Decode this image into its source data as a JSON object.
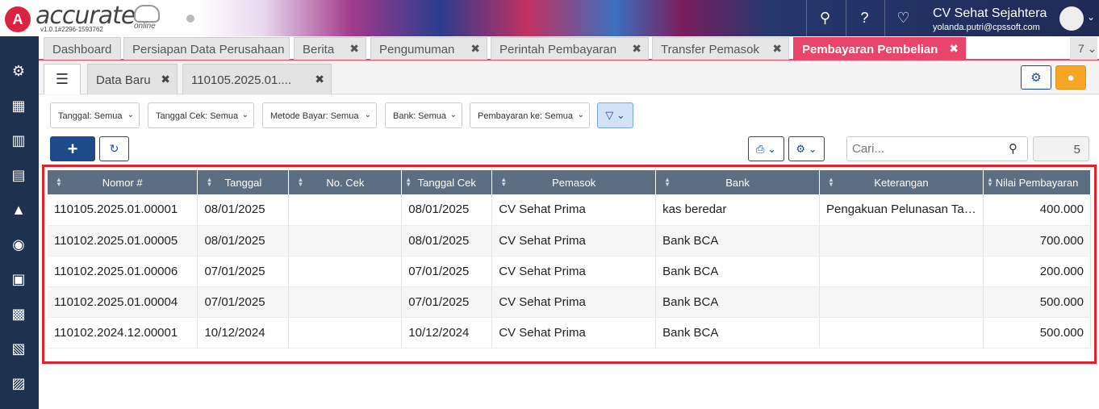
{
  "header": {
    "brand": "accurate",
    "brand_sub": "online",
    "version": "v1.0.1#2296-1593762",
    "company": "CV Sehat Sejahtera",
    "email": "yolanda.putri@cpssoft.com"
  },
  "tabs": [
    {
      "label": "Dashboard"
    },
    {
      "label": "Persiapan Data Perusahaan"
    },
    {
      "label": "Berita"
    },
    {
      "label": "Pengumuman"
    },
    {
      "label": "Perintah Pembayaran"
    },
    {
      "label": "Transfer Pemasok"
    },
    {
      "label": "Pembayaran Pembelian"
    }
  ],
  "tabs_more": "7",
  "subtabs": [
    {
      "label": "Data Baru"
    },
    {
      "label": "110105.2025.01...."
    }
  ],
  "filters": {
    "tanggal": "Tanggal: Semua",
    "tanggal_cek": "Tanggal Cek: Semua",
    "metode_bayar": "Metode Bayar: Semua",
    "bank": "Bank: Semua",
    "pembayaran_ke": "Pembayaran ke: Semua"
  },
  "search": {
    "placeholder": "Cari..."
  },
  "record_count": "5",
  "table": {
    "columns": [
      "Nomor #",
      "Tanggal",
      "No. Cek",
      "Tanggal Cek",
      "Pemasok",
      "Bank",
      "Keterangan",
      "Nilai Pembayaran"
    ],
    "rows": [
      [
        "110105.2025.01.00001",
        "08/01/2025",
        "",
        "08/01/2025",
        "CV Sehat Prima",
        "kas beredar",
        "Pengakuan Pelunasan Tagi...",
        "400.000"
      ],
      [
        "110102.2025.01.00005",
        "08/01/2025",
        "",
        "08/01/2025",
        "CV Sehat Prima",
        "Bank BCA",
        "",
        "700.000"
      ],
      [
        "110102.2025.01.00006",
        "07/01/2025",
        "",
        "07/01/2025",
        "CV Sehat Prima",
        "Bank BCA",
        "",
        "200.000"
      ],
      [
        "110102.2025.01.00004",
        "07/01/2025",
        "",
        "07/01/2025",
        "CV Sehat Prima",
        "Bank BCA",
        "",
        "500.000"
      ],
      [
        "110102.2024.12.00001",
        "10/12/2024",
        "",
        "10/12/2024",
        "CV Sehat Prima",
        "Bank BCA",
        "",
        "500.000"
      ]
    ]
  },
  "colors": {
    "accent": "#e9446a",
    "primary": "#1f4a8a",
    "sidebar": "#1e3250",
    "header_row": "#5c6e82",
    "highlight": "#d9252f"
  }
}
